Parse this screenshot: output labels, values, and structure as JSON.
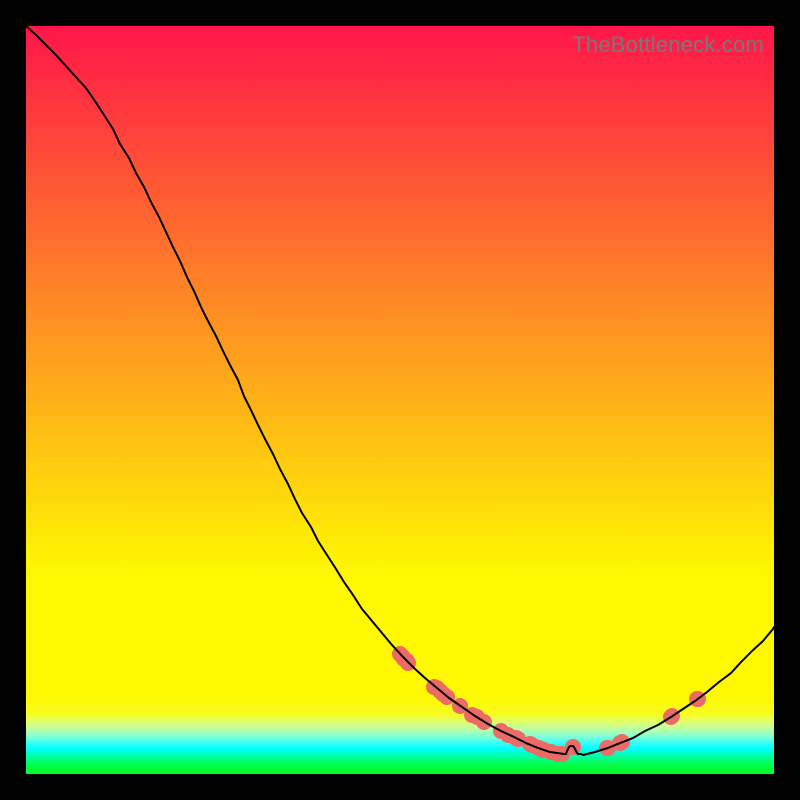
{
  "watermark": "TheBottleneck.com",
  "chart_data": {
    "type": "line",
    "title": "",
    "xlabel": "",
    "ylabel": "",
    "xlim": [
      0,
      100
    ],
    "ylim": [
      0,
      100
    ],
    "curve": [
      {
        "x": 0.0,
        "y": 100.0
      },
      {
        "x": 1.34,
        "y": 98.8
      },
      {
        "x": 2.67,
        "y": 97.46
      },
      {
        "x": 4.01,
        "y": 96.12
      },
      {
        "x": 5.35,
        "y": 94.65
      },
      {
        "x": 6.68,
        "y": 93.18
      },
      {
        "x": 8.02,
        "y": 91.71
      },
      {
        "x": 9.22,
        "y": 89.97
      },
      {
        "x": 10.43,
        "y": 88.1
      },
      {
        "x": 11.63,
        "y": 86.23
      },
      {
        "x": 12.57,
        "y": 84.22
      },
      {
        "x": 13.77,
        "y": 82.35
      },
      {
        "x": 14.71,
        "y": 80.35
      },
      {
        "x": 15.78,
        "y": 78.48
      },
      {
        "x": 16.71,
        "y": 76.47
      },
      {
        "x": 17.78,
        "y": 74.47
      },
      {
        "x": 18.72,
        "y": 72.46
      },
      {
        "x": 19.65,
        "y": 70.45
      },
      {
        "x": 20.59,
        "y": 68.58
      },
      {
        "x": 21.52,
        "y": 66.44
      },
      {
        "x": 22.46,
        "y": 64.57
      },
      {
        "x": 23.4,
        "y": 62.43
      },
      {
        "x": 24.33,
        "y": 60.56
      },
      {
        "x": 25.4,
        "y": 58.56
      },
      {
        "x": 26.34,
        "y": 56.55
      },
      {
        "x": 27.27,
        "y": 54.68
      },
      {
        "x": 28.34,
        "y": 52.67
      },
      {
        "x": 29.14,
        "y": 50.53
      },
      {
        "x": 30.08,
        "y": 48.66
      },
      {
        "x": 31.02,
        "y": 46.66
      },
      {
        "x": 31.95,
        "y": 44.79
      },
      {
        "x": 33.02,
        "y": 42.78
      },
      {
        "x": 33.96,
        "y": 40.77
      },
      {
        "x": 35.03,
        "y": 38.77
      },
      {
        "x": 35.96,
        "y": 36.76
      },
      {
        "x": 36.9,
        "y": 34.89
      },
      {
        "x": 38.1,
        "y": 33.02
      },
      {
        "x": 39.04,
        "y": 31.15
      },
      {
        "x": 40.24,
        "y": 29.28
      },
      {
        "x": 41.44,
        "y": 27.41
      },
      {
        "x": 42.51,
        "y": 25.67
      },
      {
        "x": 43.72,
        "y": 23.93
      },
      {
        "x": 44.92,
        "y": 22.06
      },
      {
        "x": 46.26,
        "y": 20.45
      },
      {
        "x": 47.59,
        "y": 18.85
      },
      {
        "x": 48.93,
        "y": 17.25
      },
      {
        "x": 50.27,
        "y": 15.78
      },
      {
        "x": 51.87,
        "y": 14.17
      },
      {
        "x": 53.34,
        "y": 12.83
      },
      {
        "x": 54.95,
        "y": 11.5
      },
      {
        "x": 56.55,
        "y": 10.16
      },
      {
        "x": 58.29,
        "y": 8.96
      },
      {
        "x": 60.03,
        "y": 7.75
      },
      {
        "x": 61.76,
        "y": 6.68
      },
      {
        "x": 63.5,
        "y": 5.75
      },
      {
        "x": 65.24,
        "y": 4.95
      },
      {
        "x": 66.84,
        "y": 4.14
      },
      {
        "x": 68.45,
        "y": 3.48
      },
      {
        "x": 70.05,
        "y": 2.94
      },
      {
        "x": 71.93,
        "y": 2.67
      },
      {
        "x": 71.93,
        "y": 2.67
      },
      {
        "x": 72.06,
        "y": 2.67
      },
      {
        "x": 72.19,
        "y": 2.67
      },
      {
        "x": 72.33,
        "y": 3.07
      },
      {
        "x": 72.46,
        "y": 3.34
      },
      {
        "x": 72.6,
        "y": 3.61
      },
      {
        "x": 72.73,
        "y": 3.74
      },
      {
        "x": 72.86,
        "y": 3.74
      },
      {
        "x": 73.0,
        "y": 3.74
      },
      {
        "x": 73.13,
        "y": 3.74
      },
      {
        "x": 73.26,
        "y": 3.61
      },
      {
        "x": 73.4,
        "y": 3.34
      },
      {
        "x": 73.53,
        "y": 3.07
      },
      {
        "x": 73.66,
        "y": 2.81
      },
      {
        "x": 73.8,
        "y": 2.67
      },
      {
        "x": 73.94,
        "y": 2.67
      },
      {
        "x": 74.06,
        "y": 2.67
      },
      {
        "x": 74.2,
        "y": 2.67
      },
      {
        "x": 74.47,
        "y": 2.54
      },
      {
        "x": 76.07,
        "y": 2.94
      },
      {
        "x": 77.81,
        "y": 3.48
      },
      {
        "x": 79.41,
        "y": 4.14
      },
      {
        "x": 81.15,
        "y": 4.81
      },
      {
        "x": 82.76,
        "y": 5.75
      },
      {
        "x": 84.49,
        "y": 6.55
      },
      {
        "x": 86.23,
        "y": 7.62
      },
      {
        "x": 87.83,
        "y": 8.69
      },
      {
        "x": 89.44,
        "y": 9.76
      },
      {
        "x": 91.04,
        "y": 10.96
      },
      {
        "x": 92.65,
        "y": 12.3
      },
      {
        "x": 94.25,
        "y": 13.5
      },
      {
        "x": 95.59,
        "y": 14.97
      },
      {
        "x": 97.06,
        "y": 16.44
      },
      {
        "x": 98.53,
        "y": 17.78
      },
      {
        "x": 99.87,
        "y": 19.39
      },
      {
        "x": 100.0,
        "y": 19.65
      }
    ],
    "dots": [
      {
        "x": 50.0,
        "y": 16.04
      },
      {
        "x": 50.27,
        "y": 15.78
      },
      {
        "x": 50.54,
        "y": 15.38
      },
      {
        "x": 50.94,
        "y": 15.11
      },
      {
        "x": 51.07,
        "y": 14.84
      },
      {
        "x": 54.55,
        "y": 11.63
      },
      {
        "x": 54.95,
        "y": 11.5
      },
      {
        "x": 55.35,
        "y": 11.1
      },
      {
        "x": 55.75,
        "y": 10.7
      },
      {
        "x": 56.29,
        "y": 10.29
      },
      {
        "x": 58.02,
        "y": 9.09
      },
      {
        "x": 59.63,
        "y": 7.89
      },
      {
        "x": 60.29,
        "y": 7.62
      },
      {
        "x": 61.23,
        "y": 6.95
      },
      {
        "x": 63.5,
        "y": 5.75
      },
      {
        "x": 64.44,
        "y": 5.21
      },
      {
        "x": 65.51,
        "y": 4.81
      },
      {
        "x": 65.78,
        "y": 4.68
      },
      {
        "x": 67.38,
        "y": 4.01
      },
      {
        "x": 67.65,
        "y": 3.88
      },
      {
        "x": 68.58,
        "y": 3.48
      },
      {
        "x": 69.12,
        "y": 3.21
      },
      {
        "x": 69.25,
        "y": 3.21
      },
      {
        "x": 70.19,
        "y": 2.94
      },
      {
        "x": 71.12,
        "y": 2.67
      },
      {
        "x": 71.66,
        "y": 2.67
      },
      {
        "x": 73.13,
        "y": 3.61
      },
      {
        "x": 77.68,
        "y": 3.48
      },
      {
        "x": 77.81,
        "y": 3.48
      },
      {
        "x": 79.41,
        "y": 4.14
      },
      {
        "x": 79.68,
        "y": 4.28
      },
      {
        "x": 86.23,
        "y": 7.62
      },
      {
        "x": 86.36,
        "y": 7.75
      },
      {
        "x": 89.71,
        "y": 10.03
      },
      {
        "x": 89.84,
        "y": 10.03
      }
    ],
    "dot_color": "#ec6b66",
    "dot_radius": 8,
    "gradient_stops": [
      {
        "offset": 0.0,
        "color": "#ff1649"
      },
      {
        "offset": 0.0813,
        "color": "#ff2f41"
      },
      {
        "offset": 0.1626,
        "color": "#ff4839"
      },
      {
        "offset": 0.2439,
        "color": "#ff6131"
      },
      {
        "offset": 0.3252,
        "color": "#ff7b29"
      },
      {
        "offset": 0.4065,
        "color": "#ff9421"
      },
      {
        "offset": 0.4878,
        "color": "#ffad19"
      },
      {
        "offset": 0.5691,
        "color": "#ffc611"
      },
      {
        "offset": 0.6504,
        "color": "#ffdf09"
      },
      {
        "offset": 0.7317,
        "color": "#fff801"
      },
      {
        "offset": 0.813,
        "color": "#fff801"
      },
      {
        "offset": 0.8943,
        "color": "#fff801"
      },
      {
        "offset": 0.92,
        "color": "#f8fc1e"
      },
      {
        "offset": 0.93,
        "color": "#e0ff6c"
      },
      {
        "offset": 0.938,
        "color": "#c3ff9a"
      },
      {
        "offset": 0.945,
        "color": "#9fffc0"
      },
      {
        "offset": 0.952,
        "color": "#72ffdf"
      },
      {
        "offset": 0.959,
        "color": "#32fff6"
      },
      {
        "offset": 0.966,
        "color": "#00ffff"
      },
      {
        "offset": 0.975,
        "color": "#00ffaf"
      },
      {
        "offset": 0.985,
        "color": "#00ff5a"
      },
      {
        "offset": 1.0,
        "color": "#00ff1f"
      }
    ]
  }
}
